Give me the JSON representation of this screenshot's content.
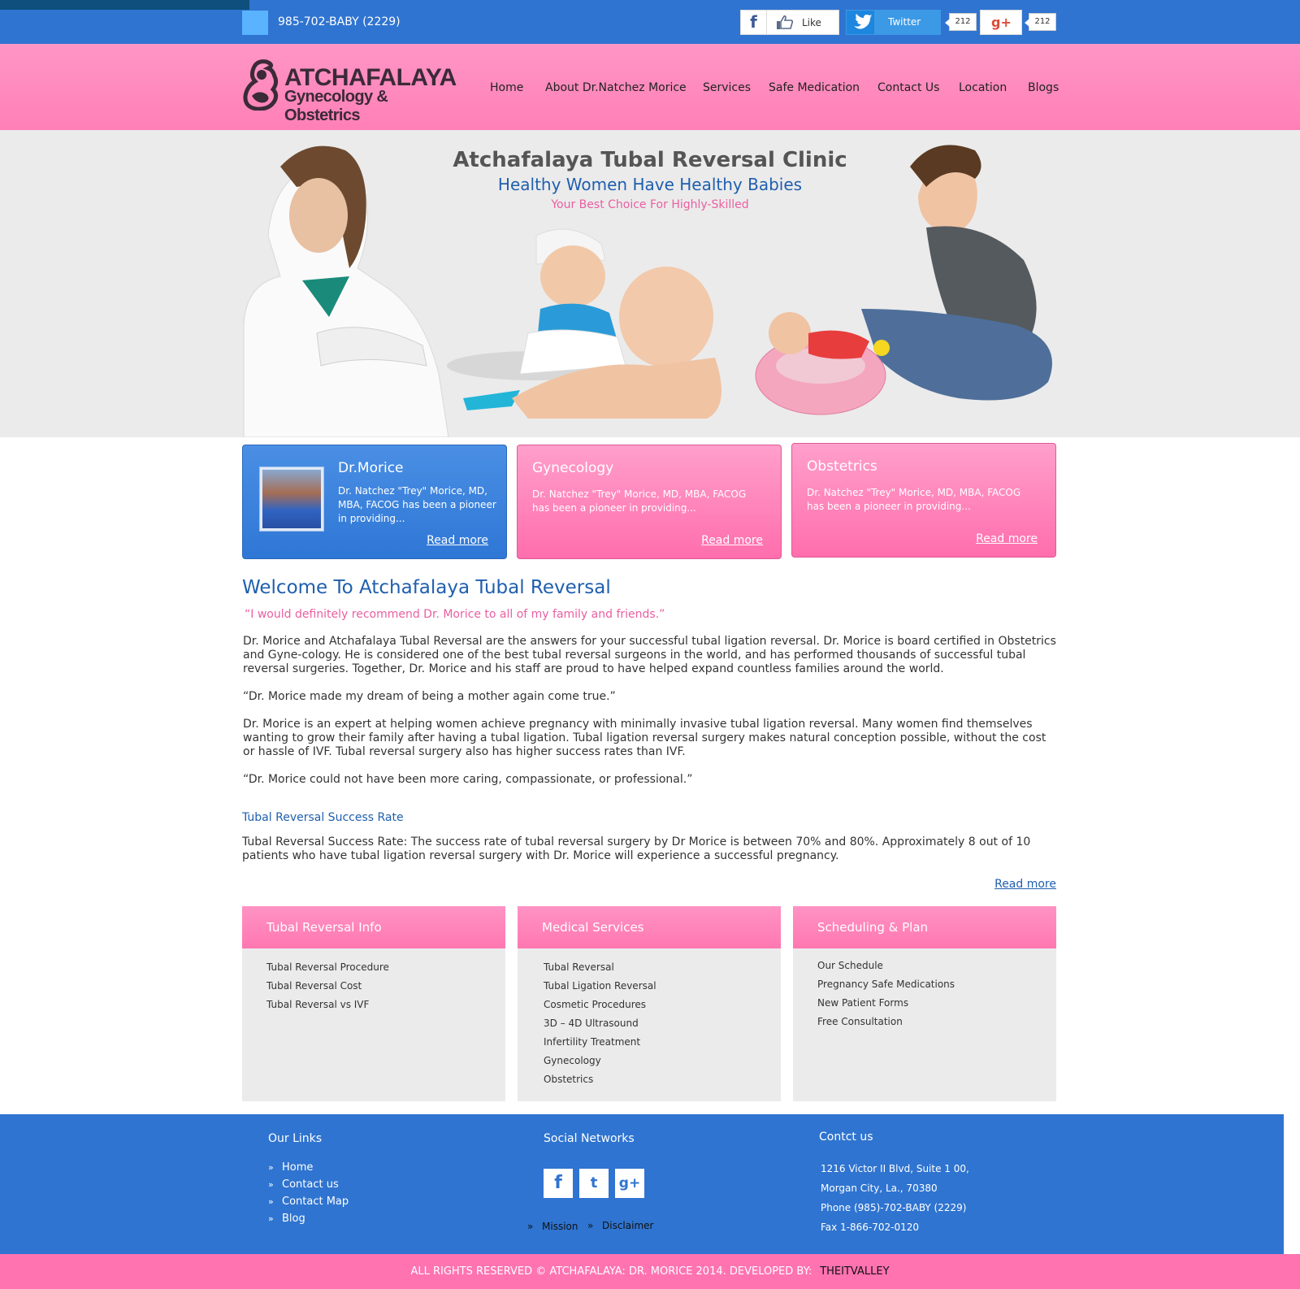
{
  "topbar": {
    "phone": "985-702-BABY (2229)",
    "facebook_like": "Like",
    "twitter_label": "Twitter",
    "twitter_count": "212",
    "gplus_label": "g+",
    "gplus_count": "212",
    "bg_color": "#2f74d0"
  },
  "header": {
    "logo_line1": "ATCHAFALAYA",
    "logo_line2": "Gynecology & Obstetrics",
    "nav": [
      "Home",
      "About Dr.Natchez Morice",
      "Services",
      "Safe Medication",
      "Contact Us",
      "Location",
      "Blogs"
    ],
    "bg_color": "#ff8fc0"
  },
  "hero": {
    "title": "Atchafalaya Tubal Reversal Clinic",
    "subtitle": "Healthy Women Have Healthy Babies",
    "tagline": "Your Best Choice For Highly-Skilled"
  },
  "features": [
    {
      "title": "Dr.Morice",
      "text": "Dr. Natchez \"Trey\" Morice, MD, MBA, FACOG has been a pioneer in providing...",
      "more": "Read more"
    },
    {
      "title": "Gynecology",
      "text": "Dr. Natchez \"Trey\" Morice, MD, MBA, FACOG has been a pioneer in providing...",
      "more": "Read more"
    },
    {
      "title": "Obstetrics",
      "text": "Dr. Natchez \"Trey\" Morice, MD, MBA, FACOG has been a pioneer in providing...",
      "more": "Read more"
    }
  ],
  "main": {
    "welcome": "Welcome To Atchafalaya Tubal Reversal",
    "quote": "“I would definitely recommend Dr. Morice to all of my family and friends.”",
    "para1": "Dr. Morice and Atchafalaya Tubal Reversal are the answers for your successful tubal ligation reversal. Dr. Morice is board certified in Obstetrics and Gyne-cology. He is considered one of the best tubal reversal surgeons in the world, and has performed thousands of successful tubal reversal surgeries. Together, Dr. Morice and his staff are proud to have helped expand countless families around the world.",
    "quote2": "“Dr. Morice made my dream of being a mother again come true.”",
    "para2": "Dr. Morice is an expert at helping women achieve pregnancy with minimally invasive tubal ligation reversal. Many women find themselves wanting to grow their family after having a tubal ligation. Tubal ligation reversal surgery makes natural conception possible, without the cost or hassle of IVF. Tubal reversal surgery also has higher success rates than IVF.",
    "quote3": "“Dr. Morice could not have been more caring, compassionate, or professional.”",
    "subhead": "Tubal Reversal Success Rate",
    "para3": "Tubal Reversal Success Rate: The success rate of tubal reversal surgery by Dr Morice is between 70% and 80%. Approximately 8 out of 10 patients who have tubal ligation reversal surgery with Dr. Morice will experience a successful pregnancy.",
    "more": "Read more"
  },
  "panels": [
    {
      "title": "Tubal Reversal Info",
      "items": [
        "Tubal Reversal Procedure",
        "Tubal Reversal Cost",
        "Tubal Reversal vs IVF"
      ]
    },
    {
      "title": "Medical Services",
      "items": [
        "Tubal Reversal",
        "Tubal Ligation Reversal",
        "Cosmetic Procedures",
        "3D – 4D Ultrasound",
        "Infertility Treatment",
        "Gynecology",
        "Obstetrics"
      ]
    },
    {
      "title": "Scheduling & Plan",
      "items": [
        "Our Schedule",
        "Pregnancy Safe Medications",
        "New Patient Forms",
        "Free Consultation"
      ]
    }
  ],
  "footer": {
    "links_title": "Our Links",
    "links": [
      "Home",
      "Contact us",
      "Contact Map",
      "Blog"
    ],
    "social_title": "Social Networks",
    "social_icons": [
      "f",
      "t",
      "g+"
    ],
    "extra_links": [
      "Mission",
      "Disclaimer"
    ],
    "contact_title": "Contct us",
    "contact": [
      "1216 Victor II Blvd, Suite 1 00,",
      "Morgan City, La., 70380",
      "Phone (985)-702-BABY (2229)",
      "Fax 1-866-702-0120"
    ],
    "copyright": "ALL RIGHTS RESERVED © ATCHAFALAYA: DR. MORICE 2014. DEVELOPED BY:",
    "developer": "THEITVALLEY"
  }
}
